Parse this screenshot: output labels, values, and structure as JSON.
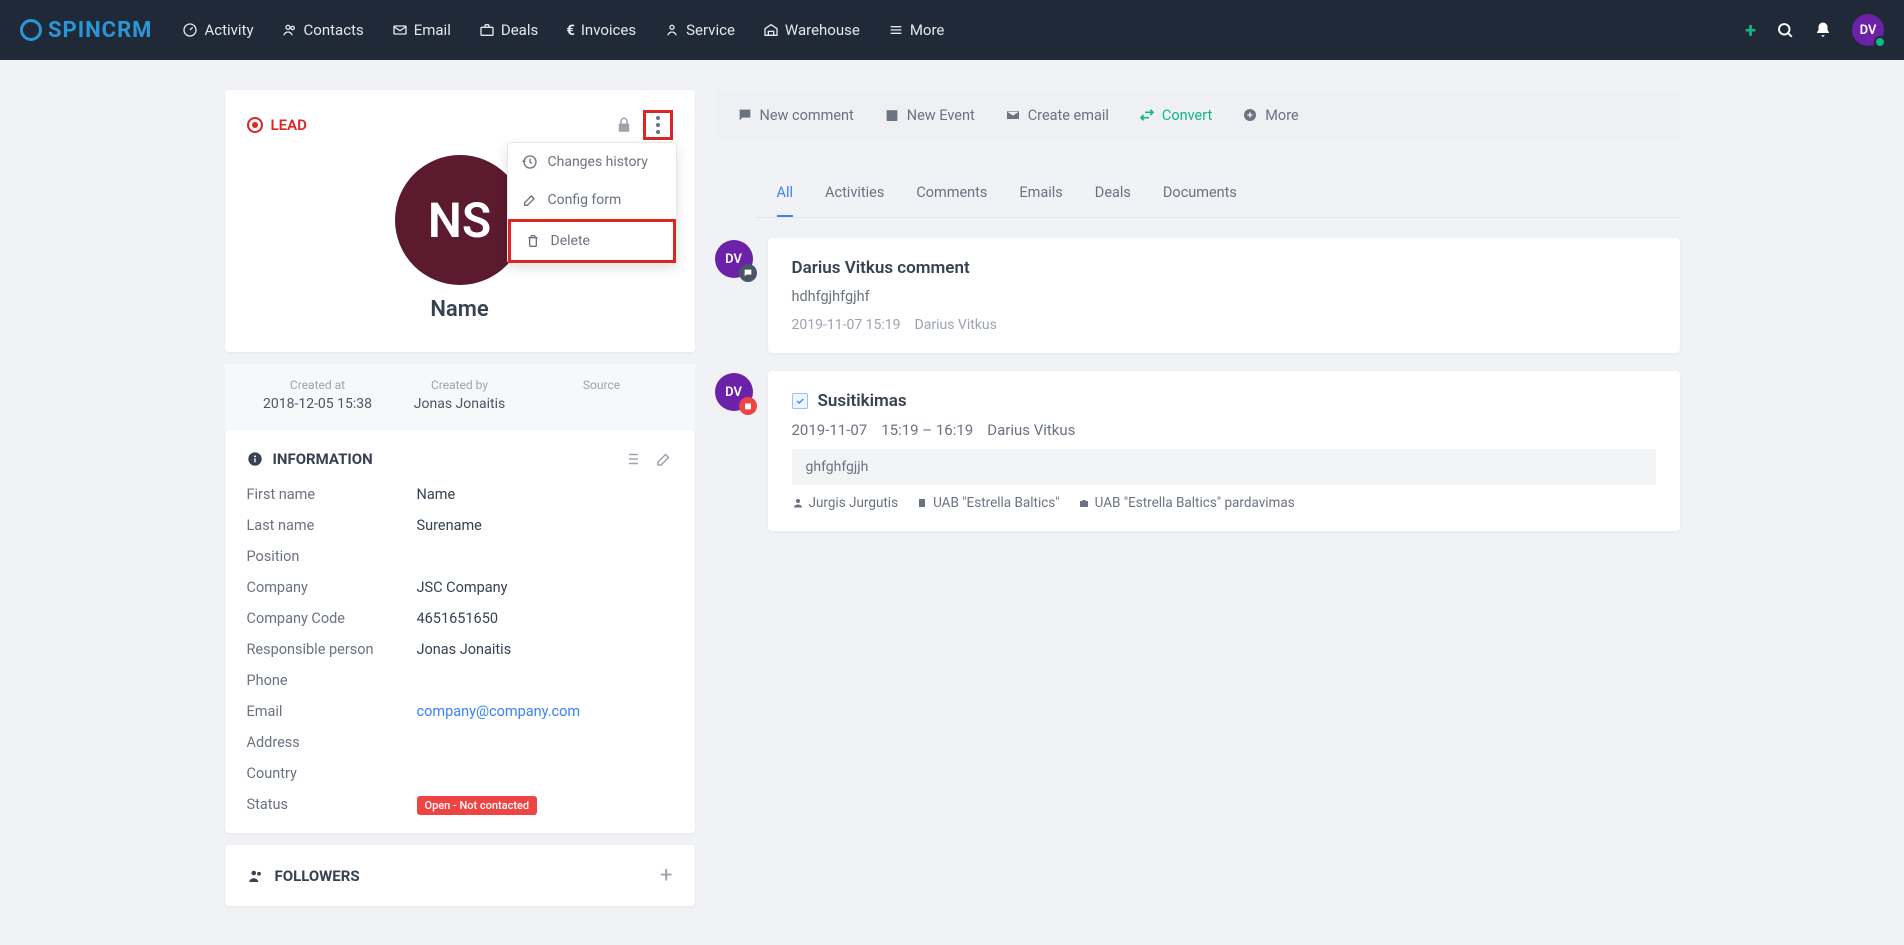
{
  "logo": "SPINCRM",
  "nav": [
    {
      "label": "Activity"
    },
    {
      "label": "Contacts"
    },
    {
      "label": "Email"
    },
    {
      "label": "Deals"
    },
    {
      "label": "Invoices"
    },
    {
      "label": "Service"
    },
    {
      "label": "Warehouse"
    },
    {
      "label": "More"
    }
  ],
  "user_initials": "DV",
  "lead": {
    "badge": "LEAD",
    "avatar_initials": "NS",
    "name": "Name",
    "created_at_label": "Created at",
    "created_at": "2018-12-05 15:38",
    "created_by_label": "Created by",
    "created_by": "Jonas Jonaitis",
    "source_label": "Source",
    "source": ""
  },
  "dropdown": {
    "history": "Changes history",
    "config": "Config form",
    "delete": "Delete"
  },
  "info": {
    "title": "INFORMATION",
    "rows": {
      "first_name_l": "First name",
      "first_name_v": "Name",
      "last_name_l": "Last name",
      "last_name_v": "Surename",
      "position_l": "Position",
      "position_v": "",
      "company_l": "Company",
      "company_v": "JSC Company",
      "company_code_l": "Company Code",
      "company_code_v": "4651651650",
      "responsible_l": "Responsible person",
      "responsible_v": "Jonas Jonaitis",
      "phone_l": "Phone",
      "phone_v": "",
      "email_l": "Email",
      "email_v": "company@company.com",
      "address_l": "Address",
      "address_v": "",
      "country_l": "Country",
      "country_v": "",
      "status_l": "Status",
      "status_v": "Open - Not contacted"
    }
  },
  "followers_title": "FOLLOWERS",
  "actions": {
    "new_comment": "New comment",
    "new_event": "New Event",
    "create_email": "Create email",
    "convert": "Convert",
    "more": "More"
  },
  "tabs": [
    "All",
    "Activities",
    "Comments",
    "Emails",
    "Deals",
    "Documents"
  ],
  "timeline": {
    "comment": {
      "title": "Darius Vitkus comment",
      "body": "hdhfgjhfgjhf",
      "date": "2019-11-07 15:19",
      "author": "Darius Vitkus",
      "avatar": "DV"
    },
    "event": {
      "title": "Susitikimas",
      "date": "2019-11-07",
      "time": "15:19 – 16:19",
      "author": "Darius Vitkus",
      "note": "ghfghfgjjh",
      "person": "Jurgis Jurgutis",
      "company": "UAB \"Estrella Baltics\"",
      "deal": "UAB \"Estrella Baltics\" pardavimas",
      "avatar": "DV"
    }
  }
}
